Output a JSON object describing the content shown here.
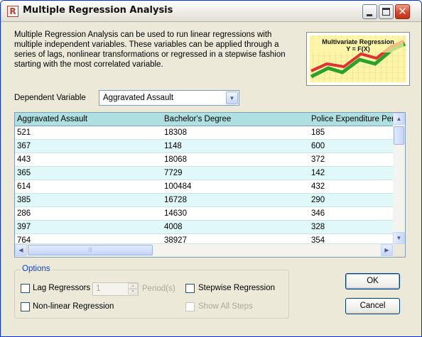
{
  "window": {
    "title": "Multiple Regression Analysis"
  },
  "description": "Multiple Regression Analysis can be used to run linear regressions with multiple independent variables. These variables can be applied through a series of lags, nonlinear transformations or regressed in a stepwise fashion starting with the most correlated variable.",
  "logo": {
    "title_line1": "Multivariate Regression",
    "title_line2": "Y = F(X)"
  },
  "dependent_variable": {
    "label": "Dependent Variable",
    "value": "Aggravated Assault"
  },
  "grid": {
    "columns": [
      "Aggravated Assault",
      "Bachelor's Degree",
      "Police Expenditure Per"
    ],
    "rows": [
      [
        "521",
        "18308",
        "185"
      ],
      [
        "367",
        "1148",
        "600"
      ],
      [
        "443",
        "18068",
        "372"
      ],
      [
        "365",
        "7729",
        "142"
      ],
      [
        "614",
        "100484",
        "432"
      ],
      [
        "385",
        "16728",
        "290"
      ],
      [
        "286",
        "14630",
        "346"
      ],
      [
        "397",
        "4008",
        "328"
      ],
      [
        "764",
        "38927",
        "354"
      ]
    ]
  },
  "options": {
    "group_label": "Options",
    "lag_regressors": "Lag Regressors",
    "lag_value": "1",
    "periods": "Period(s)",
    "stepwise": "Stepwise Regression",
    "nonlinear": "Non-linear Regression",
    "show_all_steps": "Show All Steps"
  },
  "buttons": {
    "ok": "OK",
    "cancel": "Cancel"
  },
  "colors": {
    "header_bg": "#aee0e2",
    "row_alt": "#e0f8f8",
    "window_bg": "#ece9d8",
    "options_label": "#0046d5"
  }
}
